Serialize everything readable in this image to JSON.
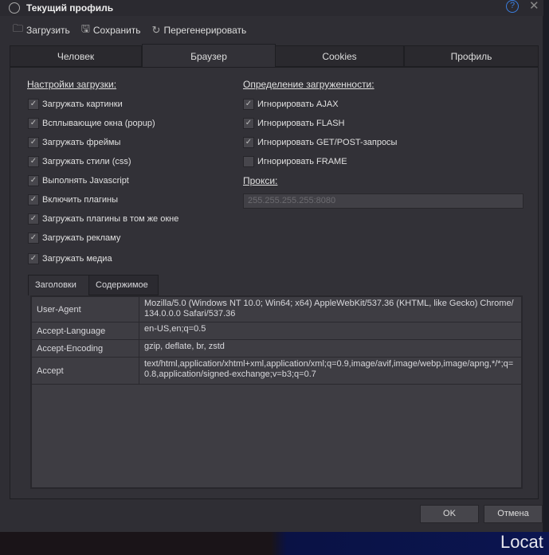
{
  "window": {
    "title": "Текущий профиль",
    "help": "?",
    "close": "✕"
  },
  "toolbar": {
    "load": "Загрузить",
    "save": "Сохранить",
    "regen": "Перегенерировать"
  },
  "tabs": [
    "Человек",
    "Браузер",
    "Cookies",
    "Профиль"
  ],
  "load_settings": {
    "heading": "Настройки загрузки:",
    "items": [
      {
        "label": "Загружать картинки",
        "checked": true
      },
      {
        "label": "Всплывающие окна (popup)",
        "checked": true
      },
      {
        "label": "Загружать фреймы",
        "checked": true
      },
      {
        "label": "Загружать стили (css)",
        "checked": true
      },
      {
        "label": "Выполнять Javascript",
        "checked": true
      },
      {
        "label": "Включить плагины",
        "checked": true
      },
      {
        "label": "Загружать плагины в том же окне",
        "checked": true
      },
      {
        "label": "Загружать рекламу",
        "checked": true
      },
      {
        "label": "Загружать медиа",
        "checked": true
      }
    ]
  },
  "load_detect": {
    "heading": "Определение загруженности:",
    "items": [
      {
        "label": "Игнорировать AJAX",
        "checked": true
      },
      {
        "label": "Игнорировать FLASH",
        "checked": true
      },
      {
        "label": "Игнорировать GET/POST-запросы",
        "checked": true
      },
      {
        "label": "Игнорировать FRAME",
        "checked": false
      }
    ]
  },
  "proxy": {
    "label": "Прокси:",
    "placeholder": "255.255.255.255:8080"
  },
  "subtabs": [
    "Заголовки",
    "Содержимое"
  ],
  "headers": [
    {
      "name": "User-Agent",
      "value": "Mozilla/5.0 (Windows NT 10.0; Win64; x64) AppleWebKit/537.36 (KHTML, like Gecko) Chrome/134.0.0.0 Safari/537.36"
    },
    {
      "name": "Accept-Language",
      "value": "en-US,en;q=0.5"
    },
    {
      "name": "Accept-Encoding",
      "value": "gzip, deflate, br, zstd"
    },
    {
      "name": "Accept",
      "value": "text/html,application/xhtml+xml,application/xml;q=0.9,image/avif,image/webp,image/apng,*/*;q=0.8,application/signed-exchange;v=b3;q=0.7"
    }
  ],
  "buttons": {
    "ok": "OK",
    "cancel": "Отмена"
  },
  "background": {
    "text": "Locat"
  }
}
